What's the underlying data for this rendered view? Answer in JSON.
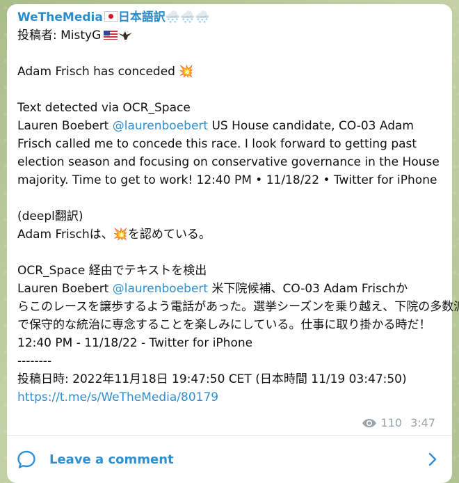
{
  "message": {
    "channel_name": "WeTheMedia",
    "channel_suffix": "日本語訳",
    "weather_emoji": "🌨️🌨️🌨️",
    "poster_line": "投稿者: MistyG",
    "headline": "Adam Frisch has conceded",
    "headline_emoji": "💥",
    "ocr_heading": "Text detected via OCR_Space",
    "ocr_author": "Lauren Boebert",
    "ocr_mention": "@laurenboebert",
    "ocr_body": "US House candidate, CO-03 Adam Frisch called me to concede this race. I look forward to getting past election season and focusing on conservative governance in the House majority. Time to get to work! 12:40 PM • 11/18/22 • Twitter for iPhone",
    "deepl_heading": "(deepl翻訳)",
    "deepl_line_prefix": "Adam Frischは、",
    "deepl_line_emoji": "💥",
    "deepl_line_suffix": "を認めている。",
    "jp_ocr_heading": "OCR_Space 経由でテキストを検出",
    "jp_ocr_author": "Lauren Boebert",
    "jp_ocr_mention": "@laurenboebert",
    "jp_ocr_body_1": "米下院候補、CO-03 Adam Frischか",
    "jp_ocr_body_2": "らこのレースを譲歩するよう電話があった。選挙シーズンを乗り越え、下院の多数派",
    "jp_ocr_body_3": "で保守的な統治に専念することを楽しみにしている。仕事に取り掛かる時だ！",
    "jp_ocr_body_4": "12:40 PM - 11/18/22 - Twitter for iPhone",
    "separator": "--------",
    "posted_line": "投稿日時: 2022年11月18日 19:47:50 CET (日本時間 11/19 03:47:50)",
    "link": "https://t.me/s/WeTheMedia/80179",
    "views": "110",
    "time": "3:47"
  },
  "comment_bar": {
    "label": "Leave a comment"
  },
  "colors": {
    "accent": "#2f8fd0",
    "meta": "#9aa4ab"
  },
  "icons": [
    "jp-flag-icon",
    "snow-cloud-icon",
    "us-flag-icon",
    "eagle-icon",
    "explosion-icon",
    "eye-icon",
    "comment-icon",
    "chevron-right-icon"
  ]
}
